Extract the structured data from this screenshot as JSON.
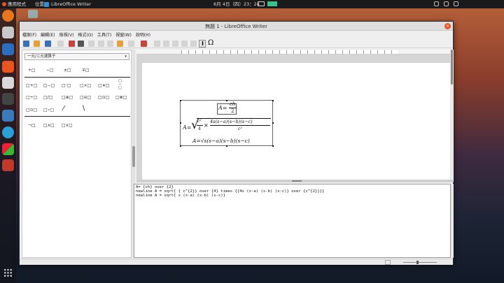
{
  "topbar": {
    "apps_label": "應用程式",
    "location_label": "位置",
    "task_label": "LibreOffice Writer",
    "clock": "6月 4日（四）23：24"
  },
  "window": {
    "title": "無題 1 - LibreOffice Writer",
    "close_label": "×"
  },
  "menu": [
    "檔案(F)",
    "編輯(E)",
    "檢視(V)",
    "格式(O)",
    "工具(T)",
    "視窗(W)",
    "說明(H)"
  ],
  "toolbar": {
    "omega_label": "Ω",
    "cursor_label": "I"
  },
  "elements_panel": {
    "category": "一元/二元運算子",
    "row1": [
      "+□",
      "−□",
      "±□",
      "∓□"
    ],
    "row2": [
      "□+□",
      "□−□",
      "□·□",
      "□×□",
      "□∗□"
    ],
    "row3": [
      "□÷□",
      "□/□",
      "□⊕□",
      "□⊖□",
      "□⊙□",
      "□⊗□"
    ],
    "row4": [
      "□⊙□",
      "□∘□"
    ],
    "row5": [
      "¬□",
      "□∧□",
      "□∨□"
    ]
  },
  "formula": {
    "line1_lhs": "A=",
    "line1_num": "ch",
    "line1_den": "2",
    "line2_lhs": "A=",
    "line2_c2": "c²",
    "line2_4": "4",
    "line2_times": "×",
    "line2_num": "4s(s−a)(s−b)(s−c)",
    "line2_den": "c²",
    "line3": "A=√s(s−a)(s−b)(s−c)"
  },
  "command_editor": {
    "lines": [
      "A= {ch} over {2}",
      "newline A = sqrt{ { c^{2}} over {4} times {{4s (s-a) (s-b) (s-c)} over {c^{2}}}}",
      "newline A = sqrt{ s (s-a) (s-b) (s-c)}"
    ]
  },
  "colors": {
    "accent": "#e95420",
    "topbar": "#1a1a1a",
    "dock": "#1f1f2a"
  }
}
